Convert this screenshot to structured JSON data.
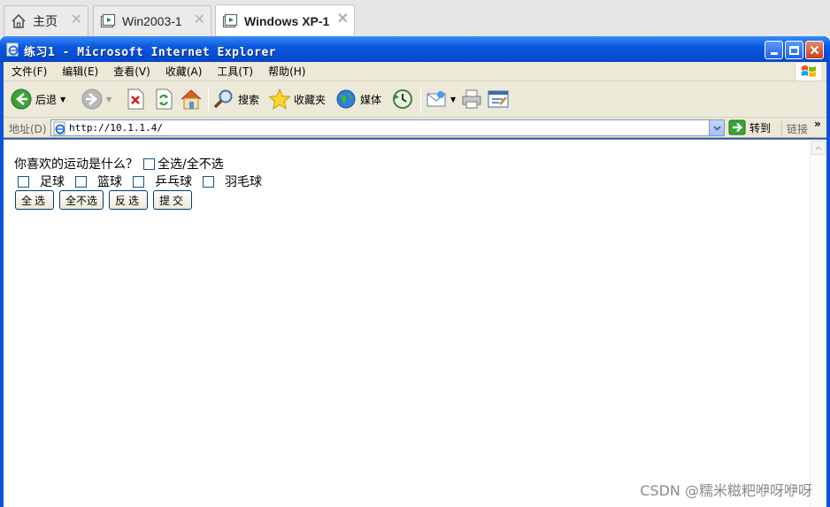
{
  "host_tabs": [
    {
      "label": "主页",
      "icon": "home-icon"
    },
    {
      "label": "Win2003-1",
      "icon": "vm-icon"
    },
    {
      "label": "Windows XP-1",
      "icon": "vm-icon",
      "active": true
    }
  ],
  "window": {
    "title": "练习1 - Microsoft Internet Explorer",
    "title_color": "#0a58e0"
  },
  "menu": [
    "文件(F)",
    "编辑(E)",
    "查看(V)",
    "收藏(A)",
    "工具(T)",
    "帮助(H)"
  ],
  "toolbar": {
    "back_label": "后退",
    "search_label": "搜索",
    "favorites_label": "收藏夹",
    "media_label": "媒体"
  },
  "address": {
    "label": "地址(D)",
    "url": "http://10.1.1.4/",
    "go_label": "转到",
    "links_label": "链接"
  },
  "page": {
    "question": "你喜欢的运动是什么？",
    "select_all_checkbox_label": "全选/全不选",
    "sports": [
      "足球",
      "篮球",
      "乒乓球",
      "羽毛球"
    ],
    "buttons": [
      "全选",
      "全不选",
      "反选",
      "提交"
    ]
  },
  "watermark": "CSDN @糯米糍粑咿呀咿呀"
}
